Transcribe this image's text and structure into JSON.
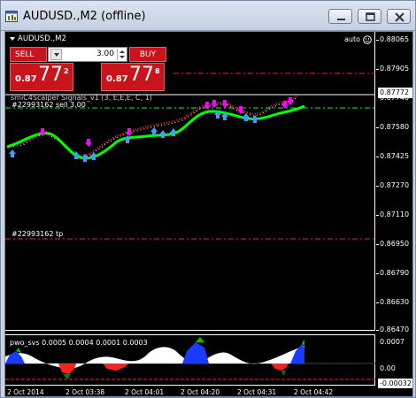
{
  "window": {
    "title": "AUDUSD.,M2 (offline)",
    "icon": "chart-window-icon",
    "buttons": [
      "minimize-icon",
      "restore-icon",
      "close-icon"
    ]
  },
  "chart": {
    "symbol": "AUDUSD.,M2",
    "auto_label": "auto",
    "indicator_label": "smiC4Scalper Signals_v1 (3, E,E,E, C, 1)",
    "order_label": "#22993162 sell 3.00",
    "tp_label": "#22993162 tp",
    "current_price": "0.87772",
    "price_axis": [
      "0.88065",
      "0.87905",
      "0.87740",
      "0.87580",
      "0.87425",
      "0.87270",
      "0.87110",
      "0.86950",
      "0.86790",
      "0.86630",
      "0.86470"
    ],
    "time_axis": [
      "2 Oct 2014",
      "2 Oct 03:38",
      "2 Oct 04:01",
      "2 Oct 04:20",
      "2 Oct 04:31",
      "2 Oct 04:42"
    ],
    "colors": {
      "background": "#000000",
      "ma_line": "#00ff00",
      "up_arrow": "#3aa0ff",
      "down_arrow": "#ff00ff",
      "order_line": "#00ff00",
      "level_line": "#ff0000"
    }
  },
  "trade_panel": {
    "sell_label": "SELL",
    "buy_label": "BUY",
    "lot_value": "3.00",
    "sell_price": {
      "small": "0.87",
      "big": "77",
      "sup": "2"
    },
    "buy_price": {
      "small": "0.87",
      "big": "77",
      "sup": "8"
    }
  },
  "indicator": {
    "label": "pwo_svs 0.0005 0.0004 0.0001 0.0003",
    "axis": [
      "0.0007",
      "0.00"
    ],
    "current_value": "-0.00032"
  }
}
